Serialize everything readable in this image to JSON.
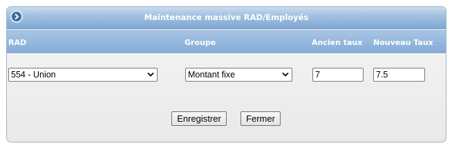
{
  "window": {
    "title": "Maintenance massive RAD/Employés",
    "title_icon": "circle-arrow-right-icon"
  },
  "columns": {
    "rad": "RAD",
    "groupe": "Groupe",
    "ancien_taux": "Ancien taux",
    "nouveau_taux": "Nouveau Taux"
  },
  "form": {
    "rad_selected": "554 - Union",
    "groupe_selected": "Montant fixe",
    "ancien_taux_value": "7",
    "nouveau_taux_value": "7.5"
  },
  "buttons": {
    "save_label": "Enregistrer",
    "close_label": "Fermer"
  },
  "colors": {
    "header_blue": "#84abd6",
    "title_white": "#ffffff"
  }
}
